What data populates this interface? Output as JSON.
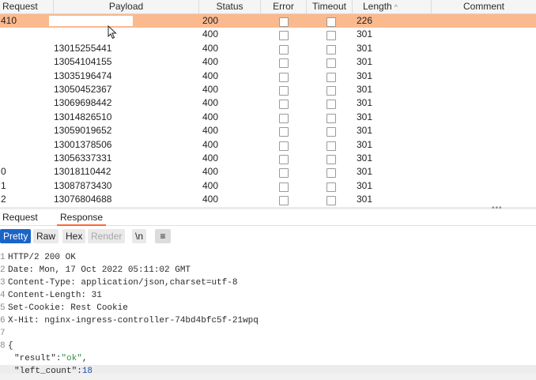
{
  "columns": {
    "request": "Request",
    "payload": "Payload",
    "status": "Status",
    "error": "Error",
    "timeout": "Timeout",
    "length": "Length",
    "length_sort": "^",
    "comment": "Comment"
  },
  "rows": [
    {
      "request": "410",
      "payload": "",
      "status": "200",
      "length": "226",
      "selected": true
    },
    {
      "request": "",
      "payload": "",
      "status": "400",
      "length": "301"
    },
    {
      "request": "",
      "payload": "13015255441",
      "status": "400",
      "length": "301"
    },
    {
      "request": "",
      "payload": "13054104155",
      "status": "400",
      "length": "301"
    },
    {
      "request": "",
      "payload": "13035196474",
      "status": "400",
      "length": "301"
    },
    {
      "request": "",
      "payload": "13050452367",
      "status": "400",
      "length": "301"
    },
    {
      "request": "",
      "payload": "13069698442",
      "status": "400",
      "length": "301"
    },
    {
      "request": "",
      "payload": "13014826510",
      "status": "400",
      "length": "301"
    },
    {
      "request": "",
      "payload": "13059019652",
      "status": "400",
      "length": "301"
    },
    {
      "request": "",
      "payload": "13001378506",
      "status": "400",
      "length": "301"
    },
    {
      "request": "",
      "payload": "13056337331",
      "status": "400",
      "length": "301"
    },
    {
      "request": "0",
      "payload": "13018110442",
      "status": "400",
      "length": "301"
    },
    {
      "request": "1",
      "payload": "13087873430",
      "status": "400",
      "length": "301"
    },
    {
      "request": "2",
      "payload": "13076804688",
      "status": "400",
      "length": "301"
    }
  ],
  "detail_tabs": {
    "request": "Request",
    "response": "Response"
  },
  "toolbar": {
    "pretty": "Pretty",
    "raw": "Raw",
    "hex": "Hex",
    "render": "Render",
    "newline": "\\n",
    "menu": "≡"
  },
  "response_lines": [
    {
      "num": "1",
      "text": "HTTP/2 200 OK"
    },
    {
      "num": "2",
      "text": "Date: Mon, 17 Oct 2022 05:11:02 GMT"
    },
    {
      "num": "3",
      "text": "Content-Type: application/json,charset=utf-8"
    },
    {
      "num": "4",
      "text": "Content-Length: 31"
    },
    {
      "num": "5",
      "text": "Set-Cookie: Rest Cookie"
    },
    {
      "num": "6",
      "text": "X-Hit: nginx-ingress-controller-74bd4bfc5f-21wpq"
    },
    {
      "num": "7",
      "text": ""
    },
    {
      "num": "8",
      "text": "{"
    }
  ],
  "json_body": {
    "result_key": "\"result\"",
    "result_value": "\"ok\"",
    "left_count_key": "\"left_count\"",
    "left_count_value": "18"
  }
}
